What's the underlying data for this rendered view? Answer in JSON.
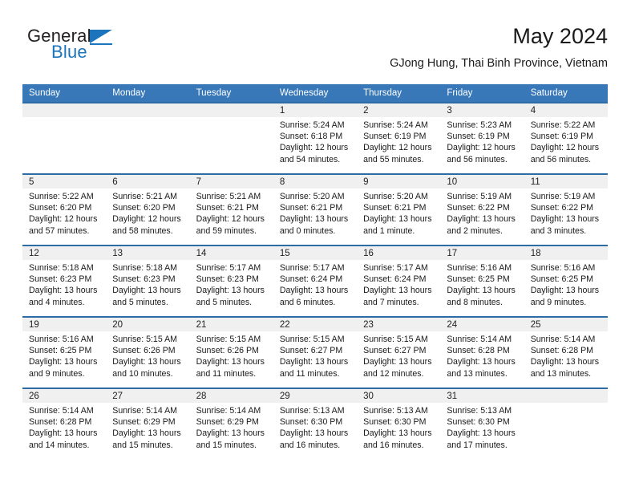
{
  "brand": {
    "name_part1": "General",
    "name_part2": "Blue",
    "logo_icon": "triangle-flag-icon",
    "accent_color": "#1c75bc"
  },
  "header": {
    "title": "May 2024",
    "subtitle": "GJong Hung, Thai Binh Province, Vietnam"
  },
  "calendar": {
    "header_bg": "#3878b8",
    "row_border_color": "#2e6da4",
    "daynum_bg": "#f0f0f0",
    "weekday_headers": [
      "Sunday",
      "Monday",
      "Tuesday",
      "Wednesday",
      "Thursday",
      "Friday",
      "Saturday"
    ],
    "weeks": [
      [
        {
          "day": "",
          "lines": []
        },
        {
          "day": "",
          "lines": []
        },
        {
          "day": "",
          "lines": []
        },
        {
          "day": "1",
          "lines": [
            "Sunrise: 5:24 AM",
            "Sunset: 6:18 PM",
            "Daylight: 12 hours",
            "and 54 minutes."
          ]
        },
        {
          "day": "2",
          "lines": [
            "Sunrise: 5:24 AM",
            "Sunset: 6:19 PM",
            "Daylight: 12 hours",
            "and 55 minutes."
          ]
        },
        {
          "day": "3",
          "lines": [
            "Sunrise: 5:23 AM",
            "Sunset: 6:19 PM",
            "Daylight: 12 hours",
            "and 56 minutes."
          ]
        },
        {
          "day": "4",
          "lines": [
            "Sunrise: 5:22 AM",
            "Sunset: 6:19 PM",
            "Daylight: 12 hours",
            "and 56 minutes."
          ]
        }
      ],
      [
        {
          "day": "5",
          "lines": [
            "Sunrise: 5:22 AM",
            "Sunset: 6:20 PM",
            "Daylight: 12 hours",
            "and 57 minutes."
          ]
        },
        {
          "day": "6",
          "lines": [
            "Sunrise: 5:21 AM",
            "Sunset: 6:20 PM",
            "Daylight: 12 hours",
            "and 58 minutes."
          ]
        },
        {
          "day": "7",
          "lines": [
            "Sunrise: 5:21 AM",
            "Sunset: 6:21 PM",
            "Daylight: 12 hours",
            "and 59 minutes."
          ]
        },
        {
          "day": "8",
          "lines": [
            "Sunrise: 5:20 AM",
            "Sunset: 6:21 PM",
            "Daylight: 13 hours",
            "and 0 minutes."
          ]
        },
        {
          "day": "9",
          "lines": [
            "Sunrise: 5:20 AM",
            "Sunset: 6:21 PM",
            "Daylight: 13 hours",
            "and 1 minute."
          ]
        },
        {
          "day": "10",
          "lines": [
            "Sunrise: 5:19 AM",
            "Sunset: 6:22 PM",
            "Daylight: 13 hours",
            "and 2 minutes."
          ]
        },
        {
          "day": "11",
          "lines": [
            "Sunrise: 5:19 AM",
            "Sunset: 6:22 PM",
            "Daylight: 13 hours",
            "and 3 minutes."
          ]
        }
      ],
      [
        {
          "day": "12",
          "lines": [
            "Sunrise: 5:18 AM",
            "Sunset: 6:23 PM",
            "Daylight: 13 hours",
            "and 4 minutes."
          ]
        },
        {
          "day": "13",
          "lines": [
            "Sunrise: 5:18 AM",
            "Sunset: 6:23 PM",
            "Daylight: 13 hours",
            "and 5 minutes."
          ]
        },
        {
          "day": "14",
          "lines": [
            "Sunrise: 5:17 AM",
            "Sunset: 6:23 PM",
            "Daylight: 13 hours",
            "and 5 minutes."
          ]
        },
        {
          "day": "15",
          "lines": [
            "Sunrise: 5:17 AM",
            "Sunset: 6:24 PM",
            "Daylight: 13 hours",
            "and 6 minutes."
          ]
        },
        {
          "day": "16",
          "lines": [
            "Sunrise: 5:17 AM",
            "Sunset: 6:24 PM",
            "Daylight: 13 hours",
            "and 7 minutes."
          ]
        },
        {
          "day": "17",
          "lines": [
            "Sunrise: 5:16 AM",
            "Sunset: 6:25 PM",
            "Daylight: 13 hours",
            "and 8 minutes."
          ]
        },
        {
          "day": "18",
          "lines": [
            "Sunrise: 5:16 AM",
            "Sunset: 6:25 PM",
            "Daylight: 13 hours",
            "and 9 minutes."
          ]
        }
      ],
      [
        {
          "day": "19",
          "lines": [
            "Sunrise: 5:16 AM",
            "Sunset: 6:25 PM",
            "Daylight: 13 hours",
            "and 9 minutes."
          ]
        },
        {
          "day": "20",
          "lines": [
            "Sunrise: 5:15 AM",
            "Sunset: 6:26 PM",
            "Daylight: 13 hours",
            "and 10 minutes."
          ]
        },
        {
          "day": "21",
          "lines": [
            "Sunrise: 5:15 AM",
            "Sunset: 6:26 PM",
            "Daylight: 13 hours",
            "and 11 minutes."
          ]
        },
        {
          "day": "22",
          "lines": [
            "Sunrise: 5:15 AM",
            "Sunset: 6:27 PM",
            "Daylight: 13 hours",
            "and 11 minutes."
          ]
        },
        {
          "day": "23",
          "lines": [
            "Sunrise: 5:15 AM",
            "Sunset: 6:27 PM",
            "Daylight: 13 hours",
            "and 12 minutes."
          ]
        },
        {
          "day": "24",
          "lines": [
            "Sunrise: 5:14 AM",
            "Sunset: 6:28 PM",
            "Daylight: 13 hours",
            "and 13 minutes."
          ]
        },
        {
          "day": "25",
          "lines": [
            "Sunrise: 5:14 AM",
            "Sunset: 6:28 PM",
            "Daylight: 13 hours",
            "and 13 minutes."
          ]
        }
      ],
      [
        {
          "day": "26",
          "lines": [
            "Sunrise: 5:14 AM",
            "Sunset: 6:28 PM",
            "Daylight: 13 hours",
            "and 14 minutes."
          ]
        },
        {
          "day": "27",
          "lines": [
            "Sunrise: 5:14 AM",
            "Sunset: 6:29 PM",
            "Daylight: 13 hours",
            "and 15 minutes."
          ]
        },
        {
          "day": "28",
          "lines": [
            "Sunrise: 5:14 AM",
            "Sunset: 6:29 PM",
            "Daylight: 13 hours",
            "and 15 minutes."
          ]
        },
        {
          "day": "29",
          "lines": [
            "Sunrise: 5:13 AM",
            "Sunset: 6:30 PM",
            "Daylight: 13 hours",
            "and 16 minutes."
          ]
        },
        {
          "day": "30",
          "lines": [
            "Sunrise: 5:13 AM",
            "Sunset: 6:30 PM",
            "Daylight: 13 hours",
            "and 16 minutes."
          ]
        },
        {
          "day": "31",
          "lines": [
            "Sunrise: 5:13 AM",
            "Sunset: 6:30 PM",
            "Daylight: 13 hours",
            "and 17 minutes."
          ]
        },
        {
          "day": "",
          "lines": []
        }
      ]
    ]
  }
}
